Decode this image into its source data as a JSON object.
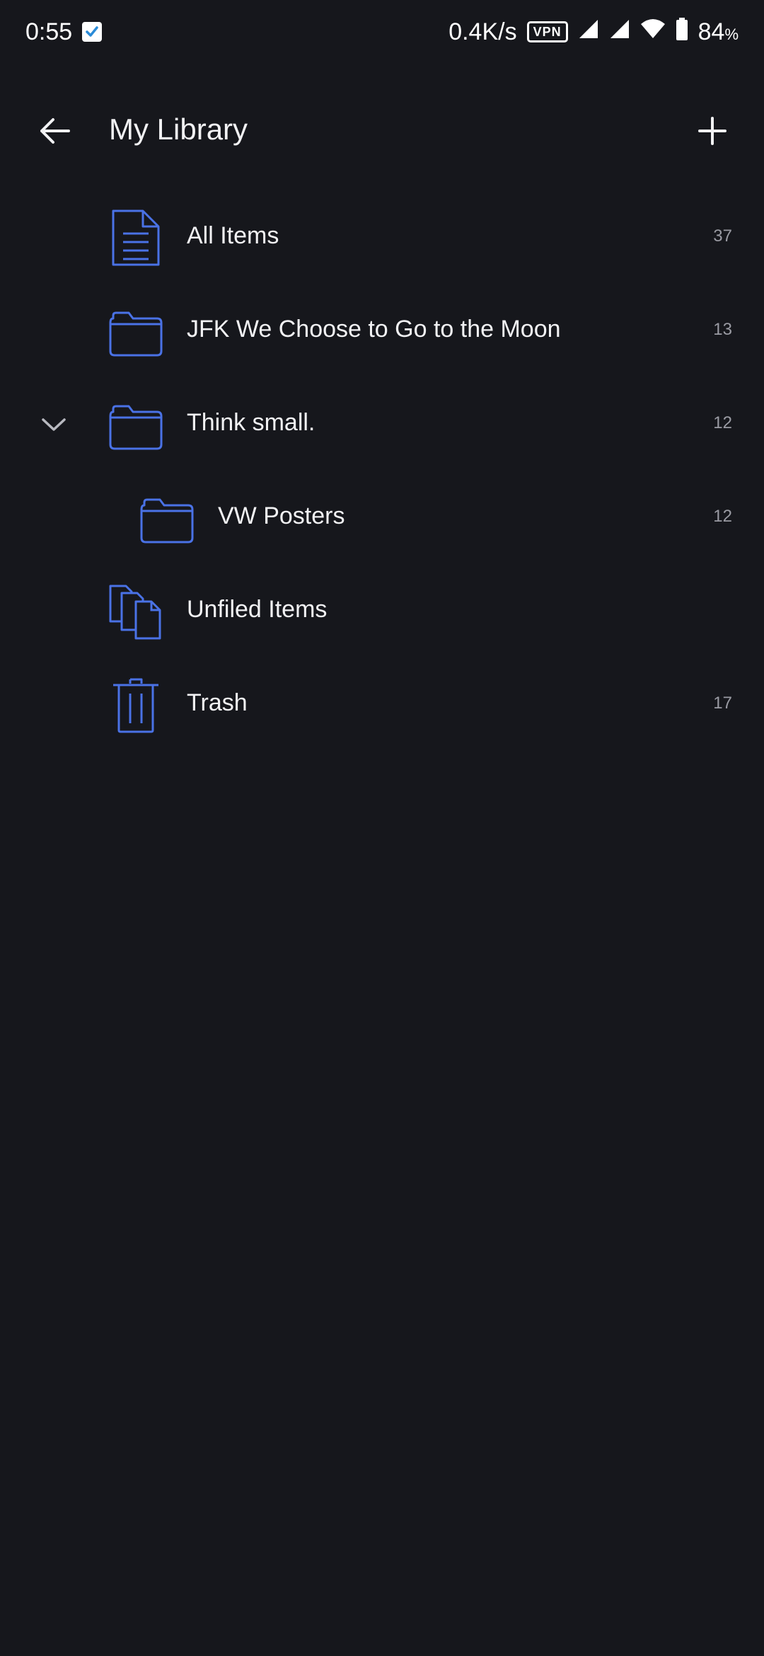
{
  "status_bar": {
    "time": "0:55",
    "network_speed": "0.4K/s",
    "vpn_label": "VPN",
    "battery_value": "84",
    "battery_unit": "%",
    "icons": [
      "checkbox-icon",
      "vpn-icon",
      "signal-icon",
      "signal-icon",
      "wifi-icon",
      "battery-icon"
    ]
  },
  "app_bar": {
    "title": "My Library",
    "back_icon": "arrow-left-icon",
    "add_icon": "plus-icon"
  },
  "colors": {
    "background": "#16171c",
    "accent": "#4a72e6",
    "text_primary": "#f2f2f4",
    "text_secondary": "#9a9ba3"
  },
  "library": {
    "items": [
      {
        "label": "All Items",
        "count": "37",
        "icon": "document-icon"
      },
      {
        "label": "JFK We Choose to Go to the Moon",
        "count": "13",
        "icon": "folder-icon"
      },
      {
        "label": "Think small.",
        "count": "12",
        "icon": "folder-icon",
        "expanded": true
      },
      {
        "label": "VW Posters",
        "count": "12",
        "icon": "folder-icon",
        "nested": true
      },
      {
        "label": "Unfiled Items",
        "count": "",
        "icon": "documents-stack-icon"
      },
      {
        "label": "Trash",
        "count": "17",
        "icon": "trash-icon"
      }
    ]
  }
}
